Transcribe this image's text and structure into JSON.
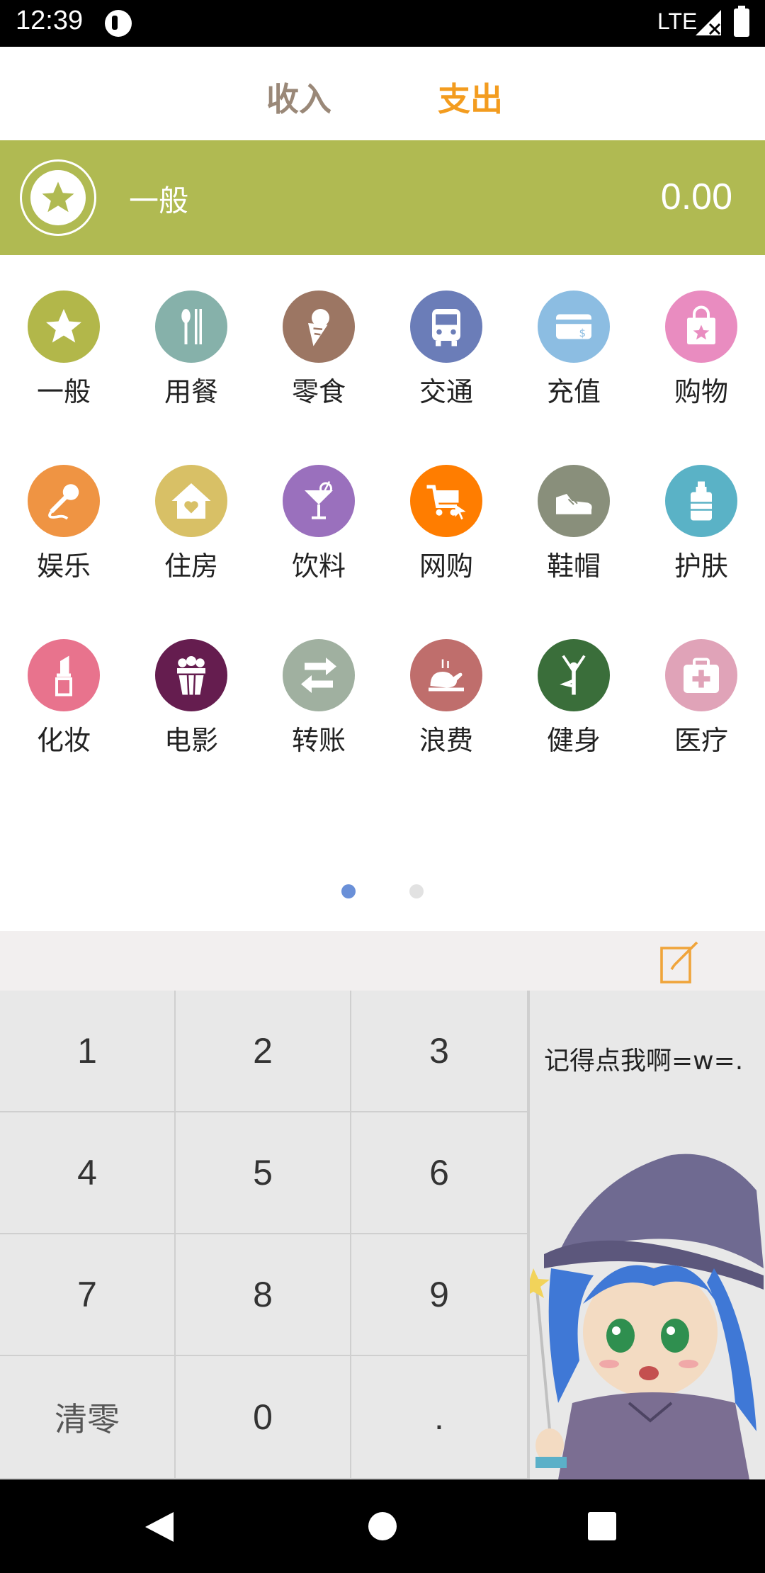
{
  "status_bar": {
    "time": "12:39",
    "network": "LTE"
  },
  "tabs": {
    "income": "收入",
    "expense": "支出"
  },
  "selected": {
    "label": "一般",
    "amount": "0.00",
    "icon": "star-icon",
    "color": "#b0ba52"
  },
  "categories": [
    {
      "label": "一般",
      "icon": "star-icon",
      "color": "#b2b74a"
    },
    {
      "label": "用餐",
      "icon": "utensils-icon",
      "color": "#86b1aa"
    },
    {
      "label": "零食",
      "icon": "ice-cream-icon",
      "color": "#9c7663"
    },
    {
      "label": "交通",
      "icon": "bus-icon",
      "color": "#6b7db8"
    },
    {
      "label": "充值",
      "icon": "card-icon",
      "color": "#8cbde2"
    },
    {
      "label": "购物",
      "icon": "shopping-bag-icon",
      "color": "#e98cc0"
    },
    {
      "label": "娱乐",
      "icon": "microphone-icon",
      "color": "#ef9443"
    },
    {
      "label": "住房",
      "icon": "house-icon",
      "color": "#d8c066"
    },
    {
      "label": "饮料",
      "icon": "cocktail-icon",
      "color": "#9a70bd"
    },
    {
      "label": "网购",
      "icon": "cart-icon",
      "color": "#ff7d00"
    },
    {
      "label": "鞋帽",
      "icon": "shoe-icon",
      "color": "#898f7b"
    },
    {
      "label": "护肤",
      "icon": "lotion-icon",
      "color": "#5ab2c6"
    },
    {
      "label": "化妆",
      "icon": "lipstick-icon",
      "color": "#e8738d"
    },
    {
      "label": "电影",
      "icon": "popcorn-icon",
      "color": "#651d4f"
    },
    {
      "label": "转账",
      "icon": "transfer-icon",
      "color": "#a0b0a0"
    },
    {
      "label": "浪费",
      "icon": "chicken-icon",
      "color": "#bf6e6c"
    },
    {
      "label": "健身",
      "icon": "yoga-icon",
      "color": "#3a6e3a"
    },
    {
      "label": "医疗",
      "icon": "medical-kit-icon",
      "color": "#e0a3b8"
    }
  ],
  "keypad": {
    "keys": [
      "1",
      "2",
      "3",
      "4",
      "5",
      "6",
      "7",
      "8",
      "9",
      "清零",
      "0",
      "."
    ],
    "side_label": "记得点我啊=w=."
  }
}
